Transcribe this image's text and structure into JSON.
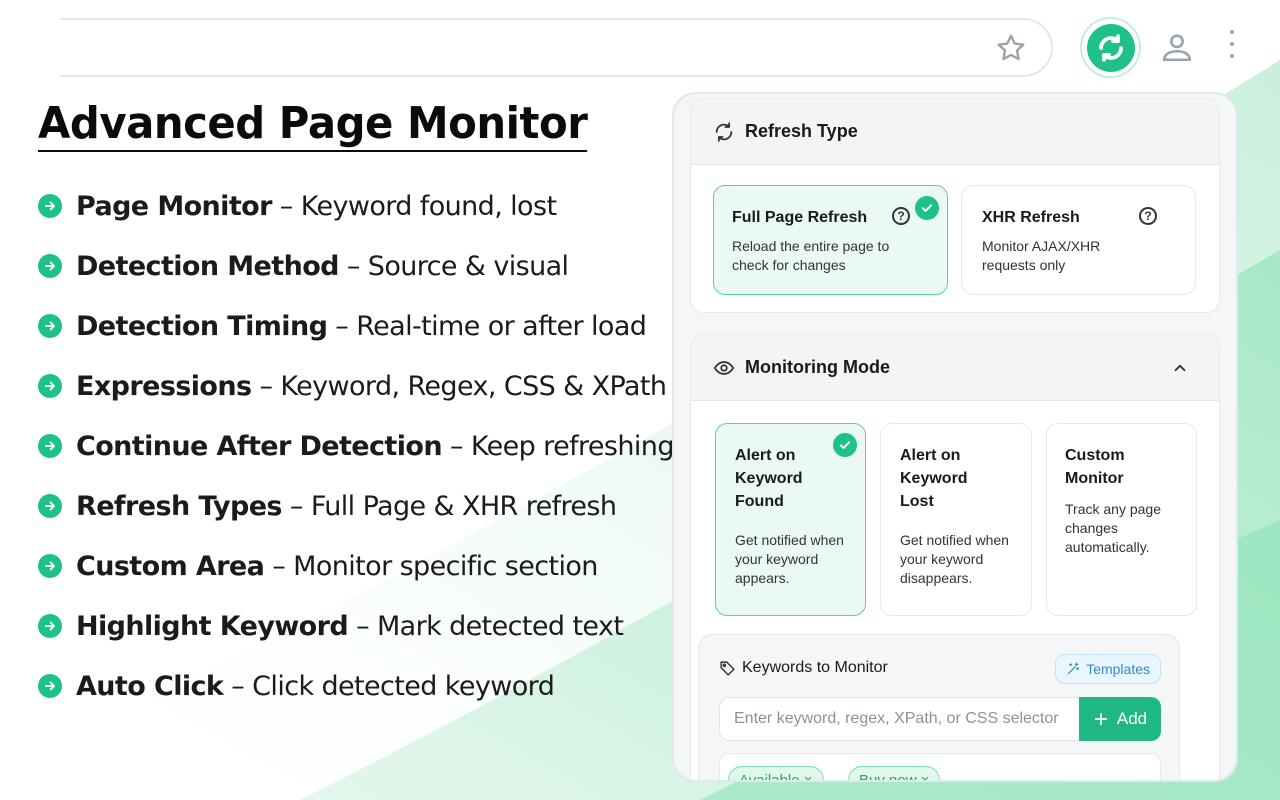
{
  "headline": "Advanced Page Monitor",
  "features": [
    {
      "name": "Page Monitor",
      "sep": "–",
      "desc": "Keyword found, lost"
    },
    {
      "name": "Detection Method",
      "sep": "–",
      "desc": "Source & visual"
    },
    {
      "name": "Detection Timing",
      "sep": "–",
      "desc": "Real-time or after load"
    },
    {
      "name": "Expressions",
      "sep": "–",
      "desc": "Keyword, Regex, CSS & XPath"
    },
    {
      "name": "Continue After Detection",
      "sep": "–",
      "desc": "Keep refreshing"
    },
    {
      "name": "Refresh Types",
      "sep": "–",
      "desc": "Full Page & XHR refresh"
    },
    {
      "name": "Custom Area",
      "sep": "–",
      "desc": "Monitor specific section"
    },
    {
      "name": "Highlight Keyword",
      "sep": "–",
      "desc": "Mark detected text"
    },
    {
      "name": "Auto Click",
      "sep": "–",
      "desc": "Click detected keyword"
    }
  ],
  "refresh_type": {
    "title": "Refresh Type",
    "options": [
      {
        "title": "Full Page Refresh",
        "desc": "Reload the entire page to check for changes",
        "selected": true
      },
      {
        "title": "XHR Refresh",
        "desc": "Monitor AJAX/XHR requests only",
        "selected": false
      }
    ]
  },
  "monitoring_mode": {
    "title": "Monitoring Mode",
    "options": [
      {
        "title": "Alert on Keyword Found",
        "desc": "Get notified when your keyword appears.",
        "selected": true
      },
      {
        "title": "Alert on Keyword Lost",
        "desc": "Get notified when your keyword disappears.",
        "selected": false
      },
      {
        "title": "Custom Monitor",
        "desc": "Track any page changes automatically.",
        "selected": false
      }
    ]
  },
  "keywords": {
    "label": "Keywords to Monitor",
    "templates_label": "Templates",
    "placeholder": "Enter keyword, regex, XPath, or CSS selector",
    "add_label": "Add",
    "tags": [
      "Available ×",
      "Buy now ×"
    ]
  },
  "colors": {
    "accent": "#1fc18a",
    "selected_bg": "#eaf9f2",
    "selected_border": "#56d3a0",
    "templates_blue": "#2d8ccc"
  },
  "icons": {
    "star": "star-icon",
    "extension": "refresh-extension-icon",
    "profile": "profile-icon",
    "menu": "kebab-menu-icon"
  }
}
